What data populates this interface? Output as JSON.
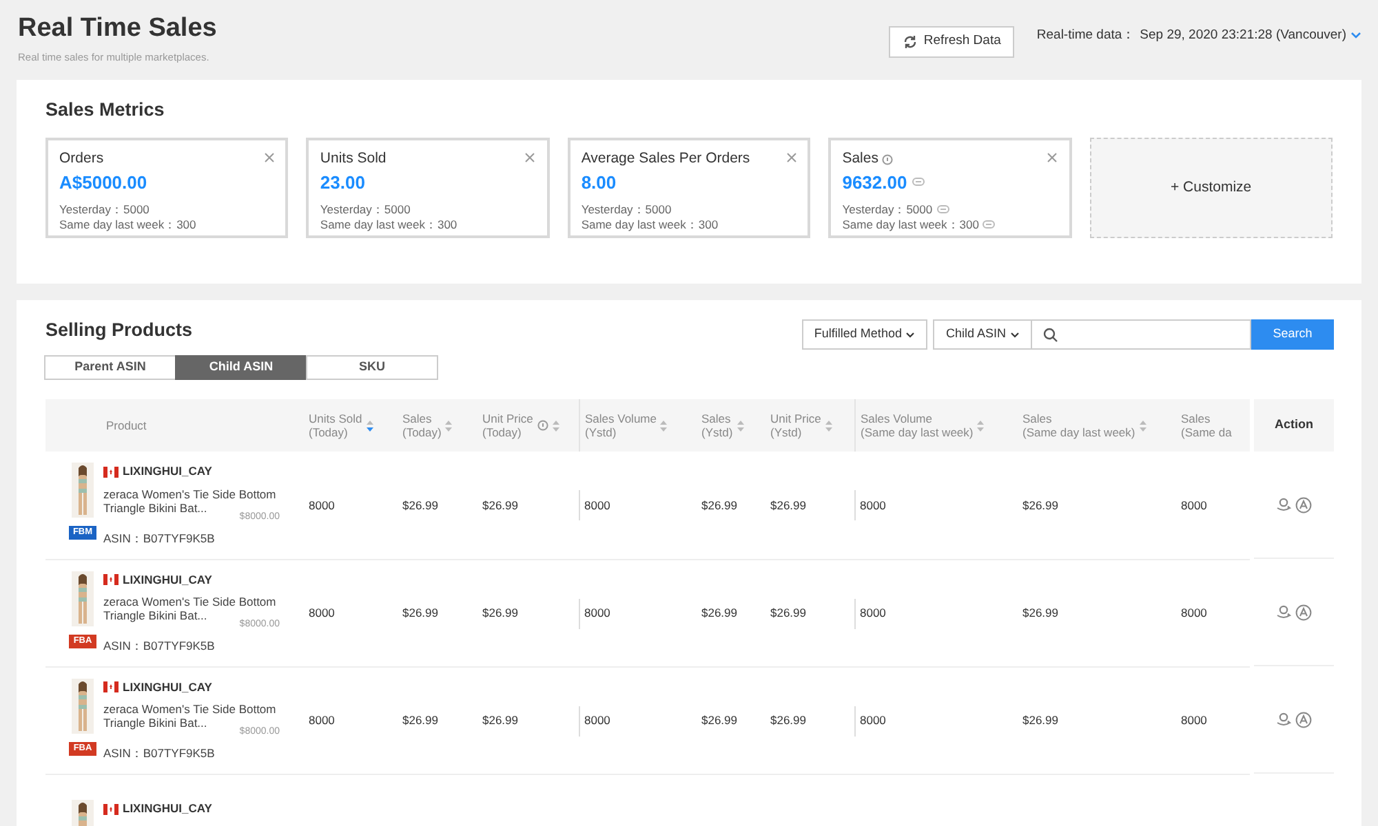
{
  "header": {
    "title": "Real Time Sales",
    "subtitle": "Real time sales for multiple marketplaces.",
    "refresh_button": "Refresh Data",
    "realtime_label": "Real-time data：",
    "realtime_value": "Sep 29, 2020 23:21:28 (Vancouver)"
  },
  "sales_metrics": {
    "title": "Sales Metrics",
    "cards": [
      {
        "label": "Orders",
        "value": "A$5000.00",
        "yesterday": "Yesterday：5000",
        "last_week": "Same day last week：300",
        "info_icon": false,
        "masked": false
      },
      {
        "label": "Units Sold",
        "value": "23.00",
        "yesterday": "Yesterday：5000",
        "last_week": "Same day last week：300",
        "info_icon": false,
        "masked": false
      },
      {
        "label": "Average Sales Per Orders",
        "value": "8.00",
        "yesterday": "Yesterday：5000",
        "last_week": "Same day last week：300",
        "info_icon": false,
        "masked": false
      },
      {
        "label": "Sales",
        "value": "9632.00",
        "yesterday": "Yesterday：5000",
        "last_week": "Same day last week：300",
        "info_icon": true,
        "masked": true
      }
    ],
    "customize": "+ Customize"
  },
  "selling_products": {
    "title": "Selling Products",
    "tabs": [
      {
        "label": "Parent ASIN",
        "selected": false
      },
      {
        "label": "Child ASIN",
        "selected": true
      },
      {
        "label": "SKU",
        "selected": false
      }
    ],
    "filter": "Fulfilled Method",
    "search_type": "Child ASIN",
    "search_button": "Search",
    "columns": [
      {
        "label": "Product",
        "kind": "plain"
      },
      {
        "label": "Units Sold\n(Today)",
        "kind": "sortable",
        "sorted": true,
        "hint": false,
        "group_start": false
      },
      {
        "label": "Sales\n(Today)",
        "kind": "sortable",
        "sorted": false,
        "hint": false,
        "group_start": false
      },
      {
        "label": "Unit Price\n(Today)",
        "kind": "sortable",
        "sorted": false,
        "hint": true,
        "group_start": false
      },
      {
        "label": "Sales Volume\n(Ystd)",
        "kind": "sortable",
        "sorted": false,
        "hint": false,
        "group_start": true
      },
      {
        "label": "Sales\n(Ystd)",
        "kind": "sortable",
        "sorted": false,
        "hint": false,
        "group_start": false
      },
      {
        "label": "Unit Price\n(Ystd)",
        "kind": "sortable",
        "sorted": false,
        "hint": false,
        "group_start": false
      },
      {
        "label": "Sales Volume\n(Same day last week)",
        "kind": "sortable",
        "sorted": false,
        "hint": false,
        "group_start": true
      },
      {
        "label": "Sales\n(Same day last week)",
        "kind": "sortable",
        "sorted": false,
        "hint": false,
        "group_start": false
      },
      {
        "label": "Sales\n(Same da",
        "kind": "plain"
      }
    ],
    "action_column": "Action",
    "rows": [
      {
        "seller": "LIXINGHUI_CAY",
        "title": "zeraca Women's Tie Side Bottom\nTriangle Bikini Bat...",
        "price": "$8000.00",
        "fulfillment": "FBM",
        "color": "#1a63c4",
        "asin_label": "ASIN：",
        "asin": "B07TYF9K5B",
        "cells": [
          "8000",
          "$26.99",
          "$26.99",
          "8000",
          "$26.99",
          "$26.99",
          "8000",
          "$26.99",
          "8000"
        ]
      },
      {
        "seller": "LIXINGHUI_CAY",
        "title": "zeraca Women's Tie Side Bottom\nTriangle Bikini Bat...",
        "price": "$8000.00",
        "fulfillment": "FBA",
        "color": "#d23a22",
        "asin_label": "ASIN：",
        "asin": "B07TYF9K5B",
        "cells": [
          "8000",
          "$26.99",
          "$26.99",
          "8000",
          "$26.99",
          "$26.99",
          "8000",
          "$26.99",
          "8000"
        ]
      },
      {
        "seller": "LIXINGHUI_CAY",
        "title": "zeraca Women's Tie Side Bottom\nTriangle Bikini Bat...",
        "price": "$8000.00",
        "fulfillment": "FBA",
        "color": "#d23a22",
        "asin_label": "ASIN：",
        "asin": "B07TYF9K5B",
        "cells": [
          "8000",
          "$26.99",
          "$26.99",
          "8000",
          "$26.99",
          "$26.99",
          "8000",
          "$26.99",
          "8000"
        ]
      },
      {
        "seller": "LIXINGHUI_CAY"
      }
    ]
  }
}
